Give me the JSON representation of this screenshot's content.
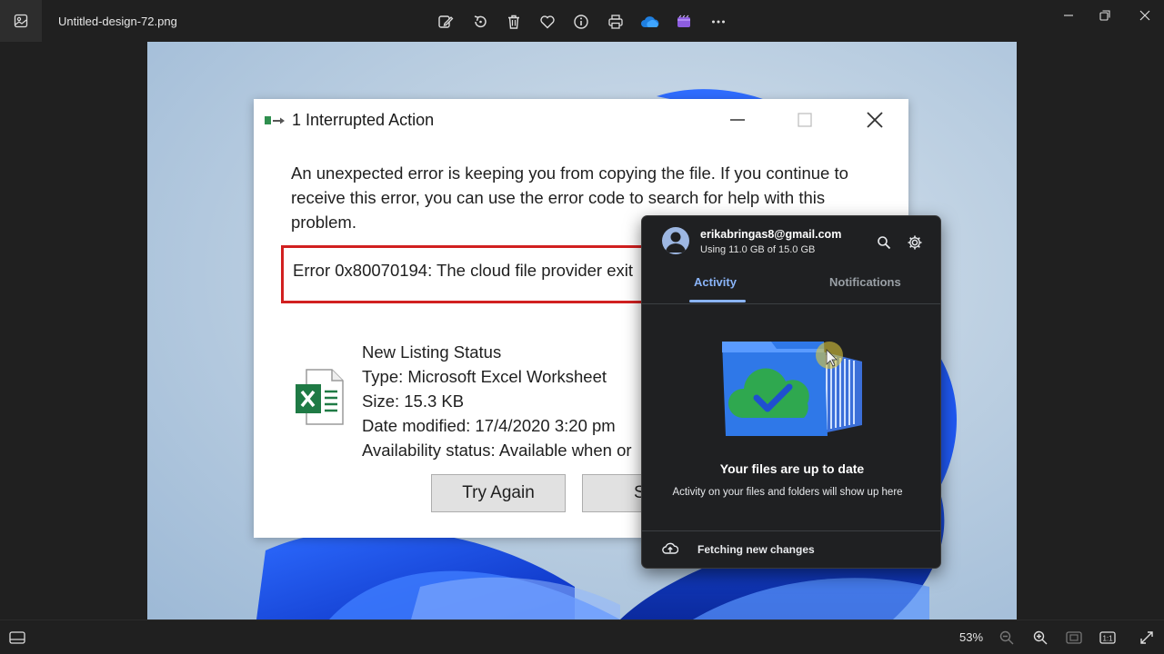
{
  "viewer": {
    "file_name": "Untitled-design-72.png",
    "zoom": "53%",
    "actual_size_label": "1:1"
  },
  "dialog": {
    "title": "1 Interrupted Action",
    "message": "An unexpected error is keeping you from copying the file. If you continue to receive this error, you can use the error code to search for help with this problem.",
    "error": "Error 0x80070194: The cloud file provider exit",
    "file": {
      "name": "New Listing Status",
      "type": "Type: Microsoft Excel Worksheet",
      "size": "Size: 15.3 KB",
      "date": "Date modified: 17/4/2020 3:20 pm",
      "availability": "Availability status: Available when or"
    },
    "buttons": {
      "try_again": "Try Again",
      "skip": "S"
    }
  },
  "onedrive": {
    "email": "erikabringas8@gmail.com",
    "usage": "Using 11.0 GB of 15.0 GB",
    "tabs": {
      "activity": "Activity",
      "notifications": "Notifications"
    },
    "status_title": "Your files are up to date",
    "status_sub": "Activity on your files and folders will show up here",
    "fetch": "Fetching new changes"
  },
  "colors": {
    "accent": "#8ab4f8",
    "error_border": "#d12020",
    "excel_green": "#1f7a45"
  }
}
